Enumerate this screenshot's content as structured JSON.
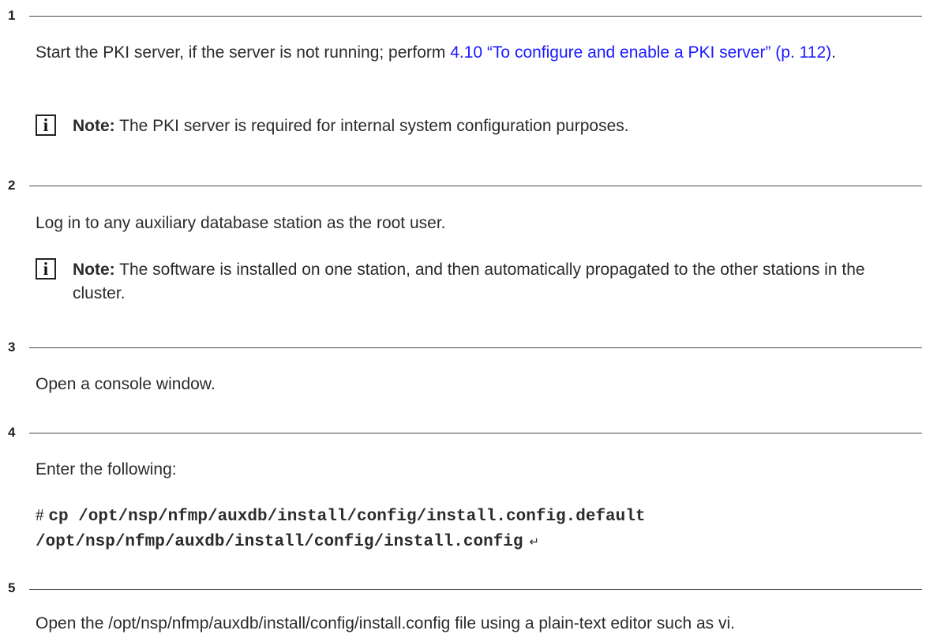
{
  "steps": [
    {
      "number": "1",
      "text_before": "Start the PKI server, if the server is not running; perform ",
      "link": "4.10 “To configure and enable a PKI server” (p. 112)",
      "text_after": ".",
      "note_label": "Note:",
      "note_text": " The PKI server is required for internal system configuration purposes."
    },
    {
      "number": "2",
      "text": "Log in to any auxiliary database station as the root user.",
      "note_label": "Note:",
      "note_text": " The software is installed on one station, and then automatically propagated to the other stations in the cluster."
    },
    {
      "number": "3",
      "text": "Open a console window."
    },
    {
      "number": "4",
      "text": "Enter the following:",
      "prompt": "#",
      "command_line1": "cp /opt/nsp/nfmp/auxdb/install/config/install.config.default",
      "command_line2": "/opt/nsp/nfmp/auxdb/install/config/install.config",
      "enter_symbol": "↵"
    },
    {
      "number": "5",
      "text": "Open the /opt/nsp/nfmp/auxdb/install/config/install.config file using a plain-text editor such as vi."
    }
  ]
}
